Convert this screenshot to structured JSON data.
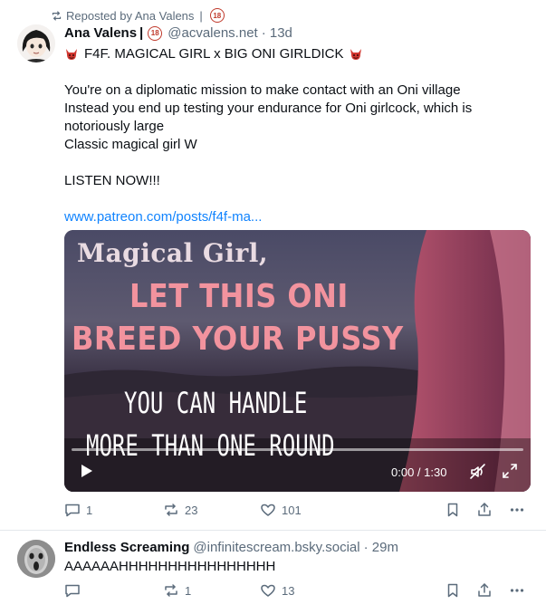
{
  "posts": [
    {
      "repost_label": "Reposted by Ana Valens",
      "repost_badge": "18",
      "author": {
        "name": "Ana Valens",
        "separator": "|",
        "badge": "18",
        "handle": "@acvalens.net",
        "time": "· 13d"
      },
      "title": "F4F. MAGICAL GIRL x BIG ONI GIRLDICK",
      "title_icon": "devil-face-emoji",
      "body_lines": [
        "You're on a diplomatic mission to make contact with an Oni village",
        "Instead you end up testing your endurance for Oni girlcock, which is",
        "notoriously large",
        "Classic magical girl W",
        "",
        "LISTEN NOW!!!",
        ""
      ],
      "link": "www.patreon.com/posts/f4f-ma...",
      "video": {
        "overlay_text": [
          "Magical Girl,",
          "LET THIS ONI",
          "BREED YOUR PUSSY",
          "YOU CAN HANDLE",
          "MORE THAN ONE ROUND"
        ],
        "time": "0:00 / 1:30",
        "progress": 0
      },
      "actions": {
        "replies": "1",
        "reposts": "23",
        "likes": "101"
      }
    },
    {
      "author": {
        "name": "Endless Screaming",
        "handle": "@infinitescream.bsky.social",
        "time": "· 29m"
      },
      "text": "AAAAAAHHHHHHHHHHHHHHHH",
      "actions": {
        "replies": "",
        "reposts": "1",
        "likes": "13"
      }
    }
  ],
  "colors": {
    "link": "#1083fe",
    "muted": "#5b6b7b",
    "badge": "#c0392b"
  }
}
